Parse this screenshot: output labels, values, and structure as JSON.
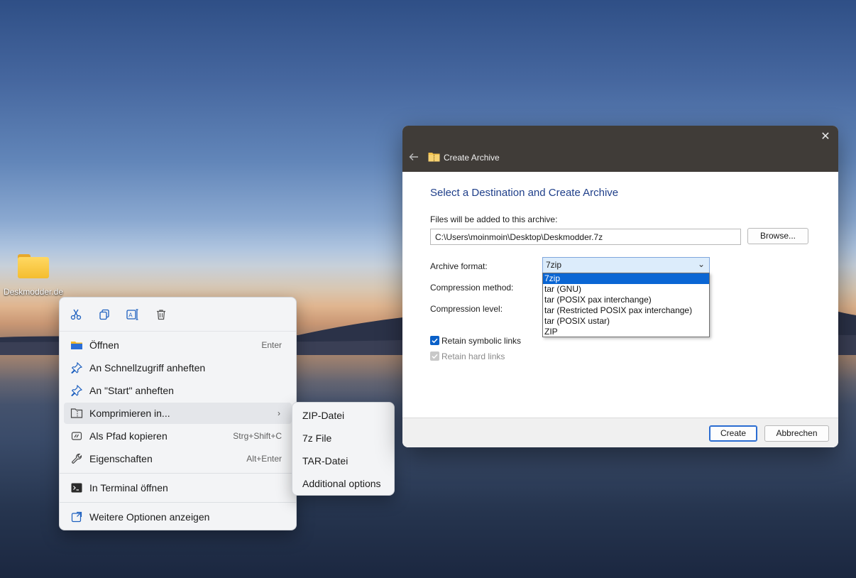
{
  "desktop": {
    "icon_label": "Deskmodder.de"
  },
  "context_menu": {
    "toolbar": [
      "scissors-icon",
      "copy-icon",
      "rename-icon",
      "trash-icon"
    ],
    "items": [
      {
        "label": "Öffnen",
        "shortcut": "Enter",
        "icon": "folder-icon"
      },
      {
        "label": "An Schnellzugriff anheften",
        "shortcut": "",
        "icon": "pin-icon"
      },
      {
        "label": "An \"Start\" anheften",
        "shortcut": "",
        "icon": "pin-icon"
      },
      {
        "label": "Komprimieren in...",
        "shortcut": "",
        "icon": "archive-icon",
        "has_submenu": true
      },
      {
        "label": "Als Pfad kopieren",
        "shortcut": "Strg+Shift+C",
        "icon": "path-icon"
      },
      {
        "label": "Eigenschaften",
        "shortcut": "Alt+Enter",
        "icon": "wrench-icon"
      },
      {
        "label": "In Terminal öffnen",
        "shortcut": "",
        "icon": "terminal-icon"
      },
      {
        "label": "Weitere Optionen anzeigen",
        "shortcut": "",
        "icon": "more-options-icon"
      }
    ]
  },
  "submenu": {
    "items": [
      "ZIP-Datei",
      "7z File",
      "TAR-Datei",
      "Additional options"
    ]
  },
  "dialog": {
    "title": "Create Archive",
    "heading": "Select a Destination and Create Archive",
    "files_label": "Files will be added to this archive:",
    "archive_path": "C:\\Users\\moinmoin\\Desktop\\Deskmodder.7z",
    "browse_label": "Browse...",
    "format_label": "Archive format:",
    "format_value": "7zip",
    "format_options": [
      "7zip",
      "tar (GNU)",
      "tar (POSIX pax interchange)",
      "tar (Restricted POSIX pax interchange)",
      "tar (POSIX ustar)",
      "ZIP"
    ],
    "method_label": "Compression method:",
    "level_label": "Compression level:",
    "retain_symbolic_label": "Retain symbolic links",
    "retain_symbolic_checked": true,
    "retain_hard_label": "Retain hard links",
    "retain_hard_checked": true,
    "create_label": "Create",
    "cancel_label": "Abbrechen"
  },
  "colors": {
    "accent": "#0a60c8",
    "dialog_header": "#403c38",
    "heading": "#1f3f8a"
  }
}
